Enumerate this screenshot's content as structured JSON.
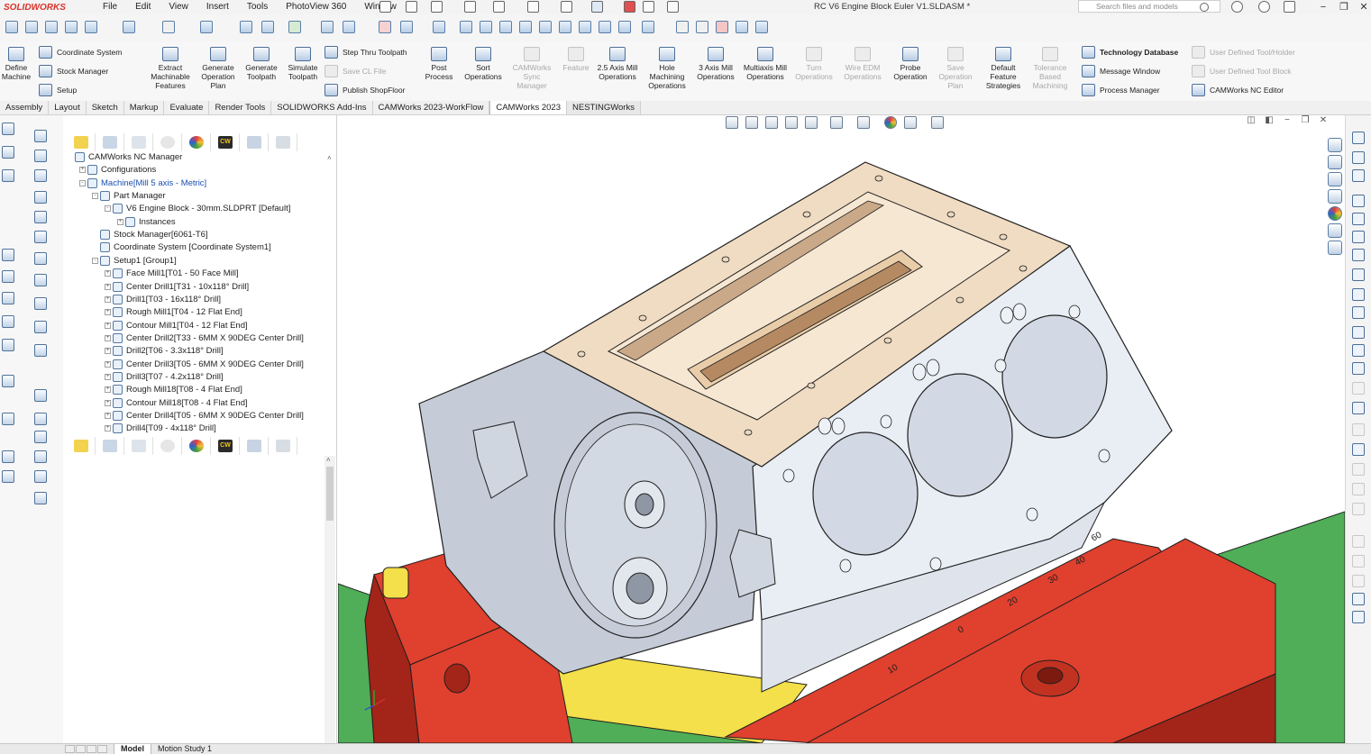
{
  "app": {
    "logo_text": "SOLIDWORKS",
    "document_title": "RC V6 Engine Block Euler V1.SLDASM *",
    "menus": [
      "File",
      "Edit",
      "View",
      "Insert",
      "Tools",
      "PhotoView 360",
      "Window"
    ],
    "search_placeholder": "Search files and models"
  },
  "ribbon": {
    "left_big": [
      {
        "label": "Define Machine"
      }
    ],
    "left_small": [
      {
        "label": "Coordinate System"
      },
      {
        "label": "Stock Manager"
      },
      {
        "label": "Setup"
      }
    ],
    "main_big": [
      {
        "label": "Extract Machinable Features",
        "disabled": false
      },
      {
        "label": "Generate Operation Plan",
        "disabled": false
      },
      {
        "label": "Generate Toolpath",
        "disabled": false
      },
      {
        "label": "Simulate Toolpath",
        "disabled": false
      }
    ],
    "toolpath_small": [
      {
        "label": "Step Thru Toolpath",
        "disabled": false
      },
      {
        "label": "Save CL File",
        "disabled": true
      },
      {
        "label": "Publish ShopFloor",
        "disabled": false
      }
    ],
    "ops_big": [
      {
        "label": "Post Process",
        "disabled": false
      },
      {
        "label": "Sort Operations",
        "disabled": false
      },
      {
        "label": "CAMWorks Sync Manager",
        "disabled": true
      },
      {
        "label": "Feature",
        "disabled": true
      },
      {
        "label": "2.5 Axis Mill Operations",
        "disabled": false
      },
      {
        "label": "Hole Machining Operations",
        "disabled": false
      },
      {
        "label": "3 Axis Mill Operations",
        "disabled": false
      },
      {
        "label": "Multiaxis Mill Operations",
        "disabled": false
      },
      {
        "label": "Turn Operations",
        "disabled": true
      },
      {
        "label": "Wire EDM Operations",
        "disabled": true
      },
      {
        "label": "Probe Operation",
        "disabled": false
      },
      {
        "label": "Save Operation Plan",
        "disabled": true
      },
      {
        "label": "Default Feature Strategies",
        "disabled": false
      },
      {
        "label": "Tolerance Based Machining",
        "disabled": true
      }
    ],
    "db_small": [
      {
        "label": "Technology Database",
        "disabled": false
      },
      {
        "label": "Message Window",
        "disabled": false
      },
      {
        "label": "Process Manager",
        "disabled": false
      }
    ],
    "tool_small": [
      {
        "label": "User Defined Tool/Holder",
        "disabled": true
      },
      {
        "label": "User Defined Tool Block",
        "disabled": true
      },
      {
        "label": "CAMWorks NC Editor",
        "disabled": false
      }
    ]
  },
  "tabs": [
    {
      "label": "Assembly",
      "state": ""
    },
    {
      "label": "Layout",
      "state": ""
    },
    {
      "label": "Sketch",
      "state": ""
    },
    {
      "label": "Markup",
      "state": ""
    },
    {
      "label": "Evaluate",
      "state": ""
    },
    {
      "label": "Render Tools",
      "state": ""
    },
    {
      "label": "SOLIDWORKS Add-Ins",
      "state": ""
    },
    {
      "label": "CAMWorks 2023-WorkFlow",
      "state": ""
    },
    {
      "label": "CAMWorks 2023",
      "state": "active"
    },
    {
      "label": "NESTINGWorks",
      "state": "highlight"
    }
  ],
  "panel_tabs": {
    "cw_label": "CW"
  },
  "tree": {
    "root": "CAMWorks NC Manager",
    "nodes": [
      {
        "label": "Configurations",
        "indent": 1,
        "expander": "+",
        "blue": false
      },
      {
        "label": "Machine[Mill 5 axis - Metric]",
        "indent": 1,
        "expander": "-",
        "blue": true
      },
      {
        "label": "Part Manager",
        "indent": 2,
        "expander": "-",
        "blue": false
      },
      {
        "label": "V6 Engine Block - 30mm.SLDPRT [Default]",
        "indent": 3,
        "expander": "-",
        "blue": false
      },
      {
        "label": "Instances",
        "indent": 4,
        "expander": "+",
        "blue": false
      },
      {
        "label": "Stock Manager[6061-T6]",
        "indent": 2,
        "expander": "",
        "blue": false
      },
      {
        "label": "Coordinate System [Coordinate System1]",
        "indent": 2,
        "expander": "",
        "blue": false
      },
      {
        "label": "Setup1 [Group1]",
        "indent": 2,
        "expander": "-",
        "blue": false
      },
      {
        "label": "Face Mill1[T01 - 50 Face Mill]",
        "indent": 3,
        "expander": "+",
        "blue": false
      },
      {
        "label": "Center Drill1[T31 - 10x118° Drill]",
        "indent": 3,
        "expander": "+",
        "blue": false
      },
      {
        "label": "Drill1[T03 - 16x118° Drill]",
        "indent": 3,
        "expander": "+",
        "blue": false
      },
      {
        "label": "Rough Mill1[T04 - 12 Flat End]",
        "indent": 3,
        "expander": "+",
        "blue": false
      },
      {
        "label": "Contour Mill1[T04 - 12 Flat End]",
        "indent": 3,
        "expander": "+",
        "blue": false
      },
      {
        "label": "Center Drill2[T33 - 6MM X 90DEG Center Drill]",
        "indent": 3,
        "expander": "+",
        "blue": false
      },
      {
        "label": "Drill2[T06 - 3.3x118° Drill]",
        "indent": 3,
        "expander": "+",
        "blue": false
      },
      {
        "label": "Center Drill3[T05 - 6MM X 90DEG Center Drill]",
        "indent": 3,
        "expander": "+",
        "blue": false
      },
      {
        "label": "Drill3[T07 - 4.2x118° Drill]",
        "indent": 3,
        "expander": "+",
        "blue": false
      },
      {
        "label": "Rough Mill18[T08 - 4 Flat End]",
        "indent": 3,
        "expander": "+",
        "blue": false
      },
      {
        "label": "Contour Mill18[T08 - 4 Flat End]",
        "indent": 3,
        "expander": "+",
        "blue": false
      },
      {
        "label": "Center Drill4[T05 - 6MM X 90DEG Center Drill]",
        "indent": 3,
        "expander": "+",
        "blue": false
      },
      {
        "label": "Drill4[T09 - 4x118° Drill]",
        "indent": 3,
        "expander": "+",
        "blue": false
      }
    ]
  },
  "viewport": {
    "vise_scale_labels": [
      "0",
      "10",
      "20",
      "30",
      "40",
      "50",
      "60"
    ],
    "colors": {
      "block_top": "#f0dcc2",
      "block_side": "#e9eef5",
      "block_front": "#c5ccd8",
      "vise_red": "#e0402e",
      "vise_dark": "#a32418",
      "base_green": "#4fae57",
      "spacer_yellow": "#f3e04a"
    }
  },
  "bottom_tabs": [
    {
      "label": "Model",
      "active": true
    },
    {
      "label": "Motion Study 1",
      "active": false
    }
  ]
}
